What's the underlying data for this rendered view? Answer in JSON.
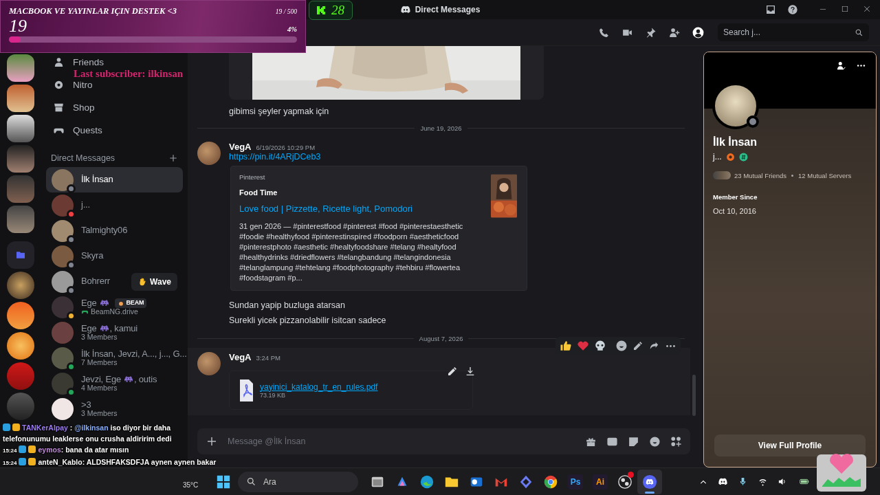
{
  "goal_overlay": {
    "title": "MACBOOK VE YAYINLAR IÇIN DESTEK <3",
    "count": "19",
    "progress_text": "19 / 500",
    "percent": "4%",
    "level": 0.04
  },
  "kick_counter": {
    "count": "28"
  },
  "last_subscriber": "Last subscriber: ilkinsan",
  "title_bar": {
    "title": "Direct Messages"
  },
  "toolbar": {
    "search_placeholder": "Search j..."
  },
  "nav_items": [
    {
      "label": "Friends"
    },
    {
      "label": "Nitro"
    },
    {
      "label": "Shop"
    },
    {
      "label": "Quests"
    }
  ],
  "dm_section": {
    "title": "Direct Messages"
  },
  "dms": [
    {
      "name": "İlk İnsan",
      "selected": true,
      "color": "#80848e"
    },
    {
      "name": "j...",
      "selected": false,
      "color": "#f23f43"
    },
    {
      "name": "Talmighty06",
      "selected": false,
      "color": "#80848e"
    },
    {
      "name": "Skyra",
      "selected": false,
      "color": "#80848e"
    },
    {
      "name": "Bohrerr",
      "selected": false,
      "color": "#80848e",
      "action": "Wave"
    },
    {
      "name": "Ege",
      "emoji": true,
      "badge": "BEAM",
      "activity": "BeamNG.drive",
      "selected": false,
      "color": "#f0b232"
    },
    {
      "name": "Ege",
      "emoji": true,
      "name_suffix": ", kamui",
      "subtitle": "3 Members",
      "selected": false
    },
    {
      "name": "İlk İnsan, Jevzi, A..., j..., G...",
      "subtitle": "7 Members",
      "selected": false,
      "color": "#23a55a"
    },
    {
      "name": "Jevzi, Ege",
      "emoji": true,
      "name_suffix": ", outis",
      "subtitle": "4 Members",
      "selected": false,
      "color": "#23a55a"
    },
    {
      "name": ">3",
      "subtitle": "3 Members",
      "selected": false
    }
  ],
  "messages": [
    {
      "kind": "image_text",
      "text": "gibimsi şeyler yapmak için"
    },
    {
      "kind": "divider",
      "date": "June 19, 2026"
    },
    {
      "kind": "embed",
      "author": "VegA",
      "time": "6/19/2026 10:29 PM",
      "link": "https://pin.it/4ARjDCeb3",
      "embed": {
        "provider": "Pinterest",
        "author": "Food Time",
        "title": "Love food | Pizzette, Ricette light, Pomodori",
        "description": "31 gen 2026 — #pinterestfood #pinterest #food #pinterestaesthetic #foodie #healthyfood #pinterestinspired #foodporn #aestheticfood #pinterestphoto #aesthetic #healtyfoodshare #telang #healtyfood #healthydrinks #driedflowers #telangbandung #telangindonesia #telanglampung #tehtelang #foodphotography #tehbiru #flowertea #foodstagram #p..."
      },
      "lines": [
        "Sundan yapip buzluga atarsan",
        "Surekli yicek pizzanolabilir isitcan sadece"
      ]
    },
    {
      "kind": "divider",
      "date": "August 7, 2026"
    },
    {
      "kind": "file",
      "author": "VegA",
      "time": "3:24 PM",
      "file_name": "yayinici_katalog_tr_en_rules.pdf",
      "file_size": "73.19 KB",
      "hovered": true
    }
  ],
  "composer": {
    "placeholder": "Message @İlk İnsan"
  },
  "profile": {
    "name": "İlk İnsan",
    "status_text": "j...",
    "mutual_friends": "23 Mutual Friends",
    "mutual_servers": "12 Mutual Servers",
    "member_since_label": "Member Since",
    "member_since": "Oct 10, 2016",
    "button": "View Full Profile"
  },
  "stream_chat": [
    {
      "user": "TANKerAlpay",
      "color": "#9d7cf4",
      "separator": ":",
      "mention": "@ilkinsan",
      "text": "iso diyor bir daha telefonunumu leaklerse onu crusha aldiririm dedi"
    },
    {
      "time": "15:24",
      "user": "eymos",
      "color": "#c08ad8",
      "text": ": bana da atar mısın"
    },
    {
      "time": "15:24",
      "user": "anteN_Kablo",
      "color": "#ffffff",
      "text": ": ALDSHFAKSDFJA aynen aynen bakar"
    }
  ],
  "taskbar": {
    "weather": "35°C",
    "search_placeholder": "Ara",
    "apps": [
      {
        "kind": "files",
        "active": false,
        "alert": false
      },
      {
        "kind": "copilot",
        "active": false,
        "alert": false
      },
      {
        "kind": "edge",
        "active": false,
        "alert": false
      },
      {
        "kind": "folder",
        "active": false,
        "alert": false
      },
      {
        "kind": "outlook",
        "active": false,
        "alert": false
      },
      {
        "kind": "gmail",
        "active": false,
        "alert": false
      },
      {
        "kind": "app",
        "active": false,
        "alert": false
      },
      {
        "kind": "chrome",
        "active": false,
        "alert": false
      },
      {
        "kind": "letters",
        "label": "Ps",
        "color": "#31a8ff",
        "active": false,
        "alert": false
      },
      {
        "kind": "letters",
        "label": "Ai",
        "color": "#ff9a00",
        "active": false,
        "alert": false
      },
      {
        "kind": "obs",
        "active": false,
        "alert": true
      },
      {
        "kind": "discord",
        "active": true,
        "alert": false
      }
    ]
  }
}
